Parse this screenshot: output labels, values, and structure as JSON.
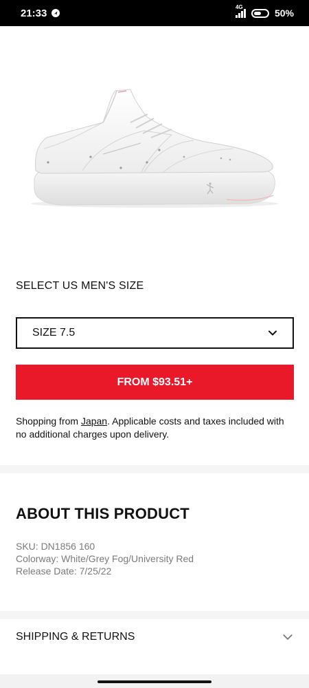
{
  "status_bar": {
    "time": "21:33",
    "network": "4G",
    "battery": "50%"
  },
  "product": {
    "image_icon": "sneaker-image"
  },
  "size_section": {
    "title": "SELECT US MEN'S SIZE",
    "selected_size": "SIZE 7.5"
  },
  "purchase": {
    "button_label": "FROM $93.51+"
  },
  "shipping_note": {
    "prefix": "Shopping from ",
    "country": "Japan",
    "suffix": ". Applicable costs and taxes included with no additional charges upon delivery."
  },
  "about": {
    "title": "ABOUT THIS PRODUCT",
    "sku": "SKU: DN1856 160",
    "colorway": "Colorway: White/Grey Fog/University Red",
    "release_date": "Release Date: 7/25/22"
  },
  "shipping_returns": {
    "label": "SHIPPING & RETURNS"
  },
  "colors": {
    "accent": "#e9192a",
    "muted_text": "#7a7a7a"
  }
}
